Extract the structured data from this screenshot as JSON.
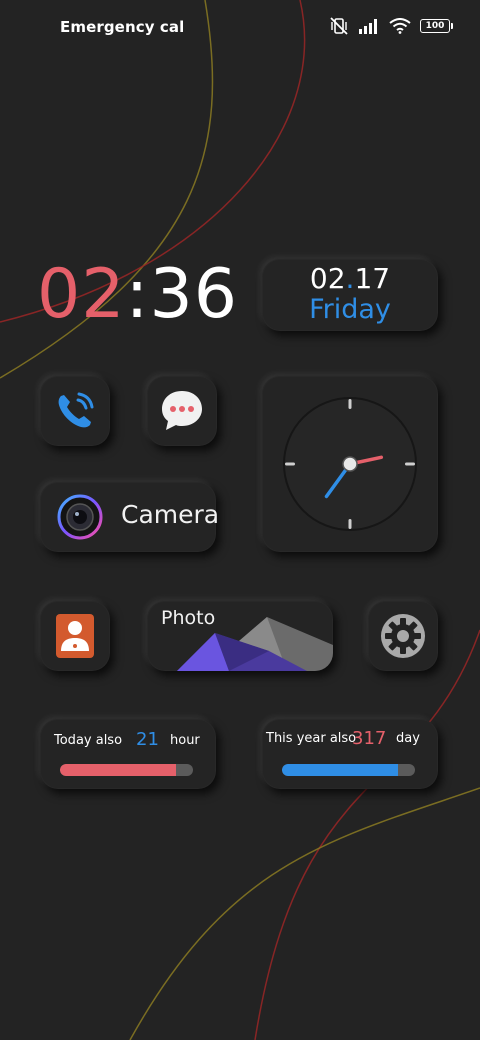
{
  "status_bar": {
    "carrier_text": "Emergency calls o",
    "battery": "100",
    "icons": [
      "vibrate-off-icon",
      "signal-icon",
      "wifi-icon",
      "battery-icon"
    ]
  },
  "clock": {
    "hours": "02",
    "separator": ":",
    "minutes": "36"
  },
  "date": {
    "month": "02",
    "dot": ".",
    "day": "17",
    "weekday": "Friday"
  },
  "apps": {
    "phone": {
      "icon": "phone-icon",
      "color": "#2f8ee6"
    },
    "messages": {
      "icon": "message-bubble-icon",
      "color": "#e5606a"
    },
    "camera": {
      "icon": "camera-lens-icon",
      "label": "Camera"
    },
    "contacts": {
      "icon": "contact-icon",
      "color": "#d35a2e"
    },
    "photo": {
      "icon": "mountain-icon",
      "label": "Photo"
    },
    "settings": {
      "icon": "gear-icon"
    }
  },
  "analog_clock": {
    "hour": 2,
    "minute": 36
  },
  "widgets": {
    "today": {
      "prefix": "Today also",
      "value": "21",
      "unit": "hour",
      "fill_fraction": 0.875,
      "color": "#e5606a"
    },
    "year": {
      "prefix": "This year also",
      "value": "317",
      "unit": "day",
      "fill_fraction": 0.87,
      "color": "#2f8ee6"
    }
  },
  "colors": {
    "accent_red": "#e5606a",
    "accent_blue": "#2f8ee6",
    "background": "#232323"
  }
}
